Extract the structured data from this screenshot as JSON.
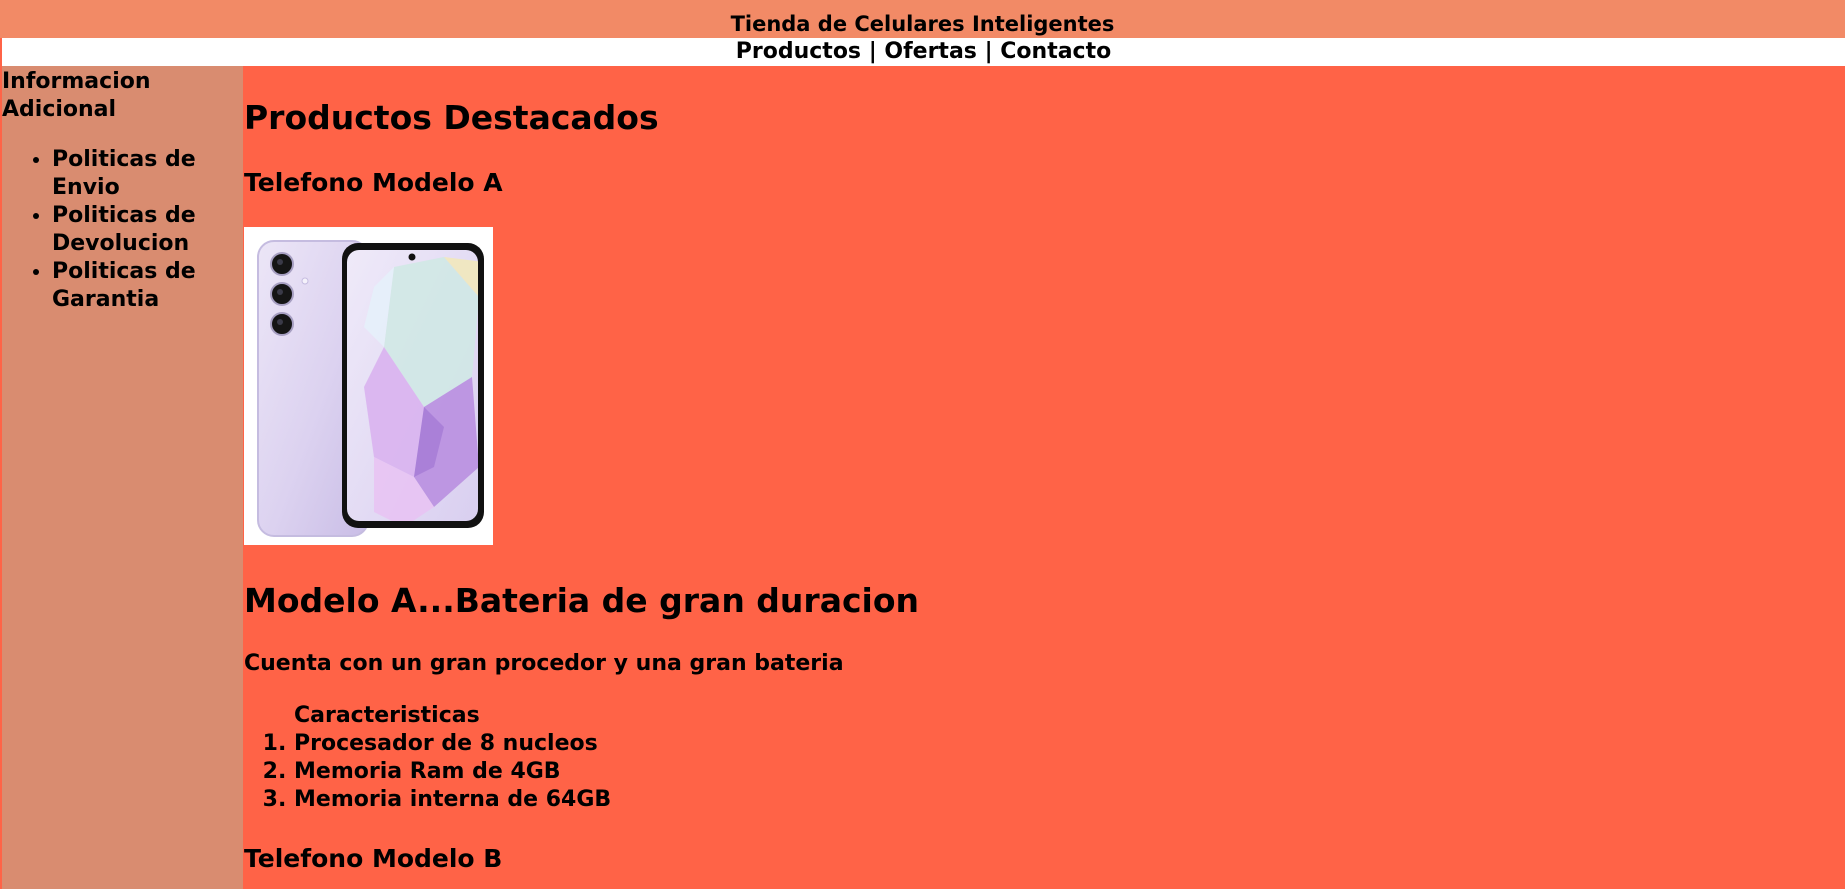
{
  "header": {
    "title": "Tienda de Celulares Inteligentes"
  },
  "nav": {
    "productos": "Productos",
    "ofertas": "Ofertas",
    "contacto": "Contacto",
    "separator": " | "
  },
  "sidebar": {
    "title": "Informacion Adicional",
    "items": [
      {
        "label": "Politicas de Envio"
      },
      {
        "label": "Politicas de Devolucion"
      },
      {
        "label": "Politicas de Garantia"
      }
    ]
  },
  "main": {
    "heading": "Productos Destacados",
    "product_a": {
      "name": "Telefono Modelo A",
      "headline": "Modelo A...Bateria de gran duracion",
      "description": "Cuenta con un gran procedor y una gran bateria",
      "features_caption": "Caracteristicas",
      "features": [
        "Procesador de 8 nucleos",
        "Memoria Ram de 4GB",
        "Memoria interna de 64GB"
      ]
    },
    "product_b": {
      "name": "Telefono Modelo B"
    }
  },
  "colors": {
    "header_bg": "#f28a66",
    "nav_bg": "#ffffff",
    "sidebar_bg": "#d98c70",
    "main_bg": "#ff6347"
  }
}
